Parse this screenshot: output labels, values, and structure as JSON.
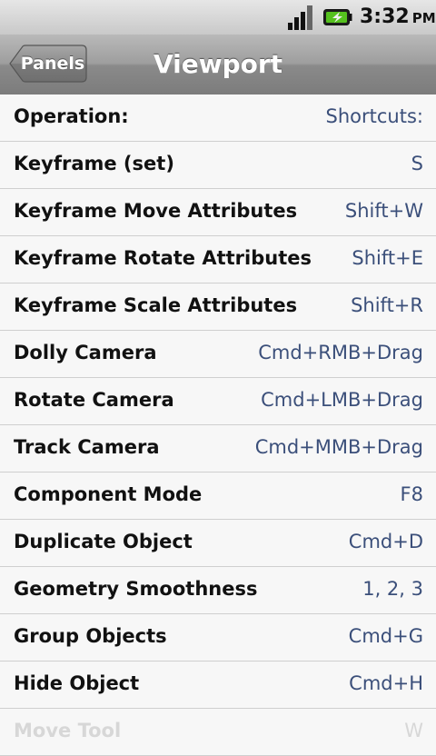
{
  "status_bar": {
    "time": "3:32",
    "ampm": "PM",
    "signal_icon": "signal-bars-icon",
    "battery_icon": "battery-charging-icon"
  },
  "nav": {
    "back_label": "Panels",
    "title": "Viewport"
  },
  "rows": [
    {
      "operation": "Operation:",
      "shortcut": "Shortcuts:"
    },
    {
      "operation": "Keyframe (set)",
      "shortcut": "S"
    },
    {
      "operation": "Keyframe Move Attributes",
      "shortcut": "Shift+W"
    },
    {
      "operation": "Keyframe Rotate Attributes",
      "shortcut": "Shift+E"
    },
    {
      "operation": "Keyframe Scale Attributes",
      "shortcut": "Shift+R"
    },
    {
      "operation": "Dolly Camera",
      "shortcut": "Cmd+RMB+Drag"
    },
    {
      "operation": "Rotate Camera",
      "shortcut": "Cmd+LMB+Drag"
    },
    {
      "operation": "Track Camera",
      "shortcut": "Cmd+MMB+Drag"
    },
    {
      "operation": "Component Mode",
      "shortcut": "F8"
    },
    {
      "operation": "Duplicate Object",
      "shortcut": "Cmd+D"
    },
    {
      "operation": "Geometry Smoothness",
      "shortcut": "1, 2, 3"
    },
    {
      "operation": "Group Objects",
      "shortcut": "Cmd+G"
    },
    {
      "operation": "Hide Object",
      "shortcut": "Cmd+H"
    },
    {
      "operation": "Move Tool",
      "shortcut": "W"
    }
  ],
  "colors": {
    "shortcut_text": "#3b4f7a",
    "navbar": "#9e9e9e"
  }
}
